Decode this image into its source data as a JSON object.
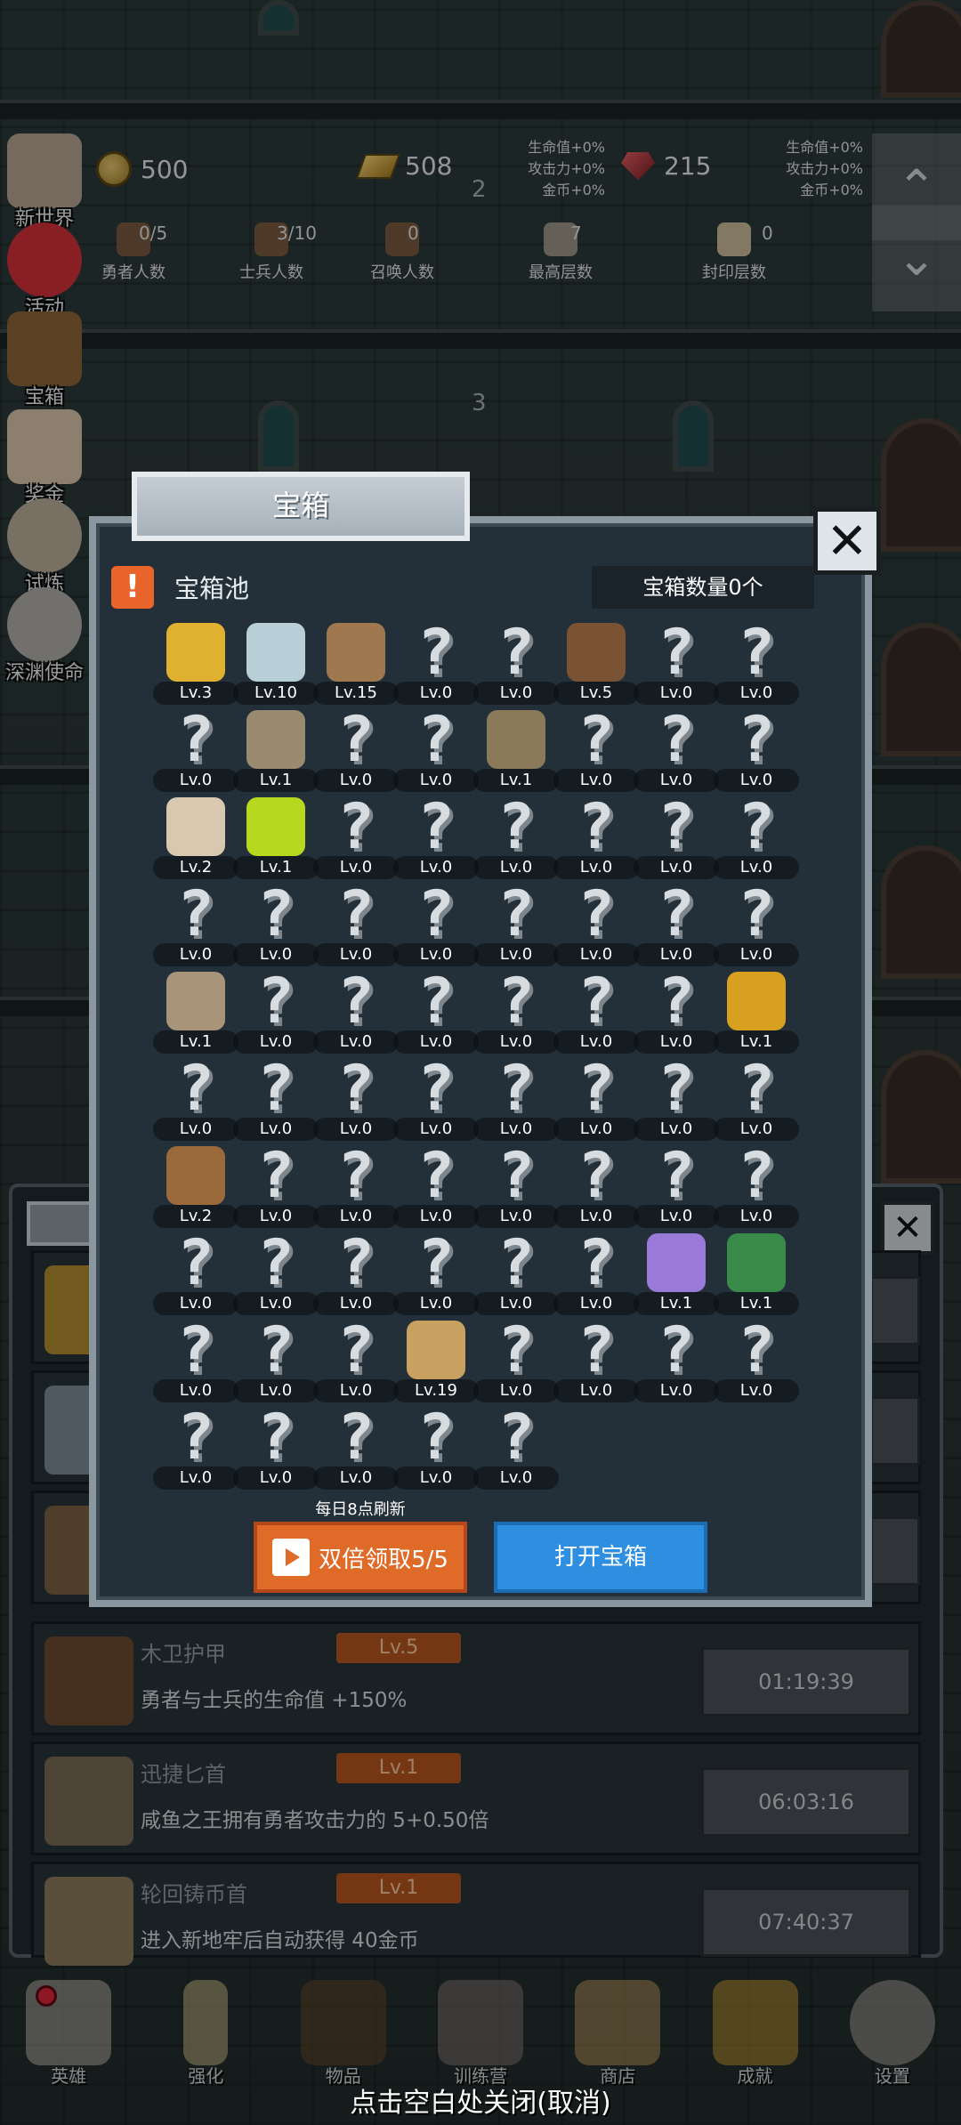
{
  "hud": {
    "coins": "500",
    "bars": "508",
    "gems": "215",
    "buff_left": [
      "生命值+0%",
      "攻击力+0%",
      "金币+0%"
    ],
    "buff_right": [
      "生命值+0%",
      "攻击力+0%",
      "金币+0%"
    ],
    "floor_top": "2",
    "floor_mid": "3",
    "stats": [
      {
        "value": "0/5",
        "label": "勇者人数"
      },
      {
        "value": "3/10",
        "label": "士兵人数"
      },
      {
        "value": "0",
        "label": "召唤人数"
      },
      {
        "value": "7",
        "label": "最高层数"
      },
      {
        "value": "0",
        "label": "封印层数"
      }
    ],
    "up_arrow": "⌃",
    "down_arrow": "⌄"
  },
  "side_menu": [
    {
      "label": "新世界",
      "icon": "stone-tablet-icon"
    },
    {
      "label": "活动",
      "icon": "heart-icon"
    },
    {
      "label": "宝箱",
      "icon": "treasure-chest-icon"
    },
    {
      "label": "奖金",
      "icon": "envelope-icon"
    },
    {
      "label": "试炼",
      "icon": "feather-icon"
    },
    {
      "label": "深渊使命",
      "icon": "orb-icon"
    }
  ],
  "modal": {
    "title": "宝箱",
    "close": "✕",
    "warn": "!",
    "pool_title": "宝箱池",
    "chest_count": "宝箱数量0个",
    "refresh_note": "每日8点刷新",
    "double_button": "双倍领取5/5",
    "open_button": "打开宝箱",
    "unknown_glyph": "?",
    "items": [
      {
        "lv": "Lv.3",
        "icon": "crown-icon",
        "color": "#e0b030"
      },
      {
        "lv": "Lv.10",
        "icon": "diamond-icon",
        "color": "#b8cfd8"
      },
      {
        "lv": "Lv.15",
        "icon": "wooden-sword-icon",
        "color": "#a07850"
      },
      {
        "lv": "Lv.0"
      },
      {
        "lv": "Lv.0"
      },
      {
        "lv": "Lv.5",
        "icon": "leather-armor-icon",
        "color": "#7a5234"
      },
      {
        "lv": "Lv.0"
      },
      {
        "lv": "Lv.0"
      },
      {
        "lv": "Lv.0"
      },
      {
        "lv": "Lv.1",
        "icon": "dagger-icon",
        "color": "#9a8a70"
      },
      {
        "lv": "Lv.0"
      },
      {
        "lv": "Lv.0"
      },
      {
        "lv": "Lv.1",
        "icon": "knight-helmet-icon",
        "color": "#8a7a5a"
      },
      {
        "lv": "Lv.0"
      },
      {
        "lv": "Lv.0"
      },
      {
        "lv": "Lv.0"
      },
      {
        "lv": "Lv.2",
        "icon": "bread-icon",
        "color": "#d8c8b0"
      },
      {
        "lv": "Lv.1",
        "icon": "potion-icon",
        "color": "#b8d820"
      },
      {
        "lv": "Lv.0"
      },
      {
        "lv": "Lv.0"
      },
      {
        "lv": "Lv.0"
      },
      {
        "lv": "Lv.0"
      },
      {
        "lv": "Lv.0"
      },
      {
        "lv": "Lv.0"
      },
      {
        "lv": "Lv.0"
      },
      {
        "lv": "Lv.0"
      },
      {
        "lv": "Lv.0"
      },
      {
        "lv": "Lv.0"
      },
      {
        "lv": "Lv.0"
      },
      {
        "lv": "Lv.0"
      },
      {
        "lv": "Lv.0"
      },
      {
        "lv": "Lv.0"
      },
      {
        "lv": "Lv.1",
        "icon": "boot-icon",
        "color": "#a89478"
      },
      {
        "lv": "Lv.0"
      },
      {
        "lv": "Lv.0"
      },
      {
        "lv": "Lv.0"
      },
      {
        "lv": "Lv.0"
      },
      {
        "lv": "Lv.0"
      },
      {
        "lv": "Lv.0"
      },
      {
        "lv": "Lv.1",
        "icon": "torch-icon",
        "color": "#d8a020"
      },
      {
        "lv": "Lv.0"
      },
      {
        "lv": "Lv.0"
      },
      {
        "lv": "Lv.0"
      },
      {
        "lv": "Lv.0"
      },
      {
        "lv": "Lv.0"
      },
      {
        "lv": "Lv.0"
      },
      {
        "lv": "Lv.0"
      },
      {
        "lv": "Lv.0"
      },
      {
        "lv": "Lv.2",
        "icon": "backpack-icon",
        "color": "#9a6a3a"
      },
      {
        "lv": "Lv.0"
      },
      {
        "lv": "Lv.0"
      },
      {
        "lv": "Lv.0"
      },
      {
        "lv": "Lv.0"
      },
      {
        "lv": "Lv.0"
      },
      {
        "lv": "Lv.0"
      },
      {
        "lv": "Lv.0"
      },
      {
        "lv": "Lv.0"
      },
      {
        "lv": "Lv.0"
      },
      {
        "lv": "Lv.0"
      },
      {
        "lv": "Lv.0"
      },
      {
        "lv": "Lv.0"
      },
      {
        "lv": "Lv.0"
      },
      {
        "lv": "Lv.1",
        "icon": "tentacle-icon",
        "color": "#9a7ad8"
      },
      {
        "lv": "Lv.1",
        "icon": "hex-amulet-icon",
        "color": "#3a8a4a"
      },
      {
        "lv": "Lv.0"
      },
      {
        "lv": "Lv.0"
      },
      {
        "lv": "Lv.0"
      },
      {
        "lv": "Lv.19",
        "icon": "beer-mug-icon",
        "color": "#c8a060"
      },
      {
        "lv": "Lv.0"
      },
      {
        "lv": "Lv.0"
      },
      {
        "lv": "Lv.0"
      },
      {
        "lv": "Lv.0"
      },
      {
        "lv": "Lv.0"
      },
      {
        "lv": "Lv.0"
      },
      {
        "lv": "Lv.0"
      },
      {
        "lv": "Lv.0"
      },
      {
        "lv": "Lv.0"
      }
    ]
  },
  "list": [
    {
      "name": "木卫护甲",
      "lv": "Lv.5",
      "desc": "勇者与士兵的生命值 +150%",
      "timer": "01:19:39",
      "icon": "leather-armor-icon",
      "color": "#6a4a30"
    },
    {
      "name": "迅捷匕首",
      "lv": "Lv.1",
      "desc": "咸鱼之王拥有勇者攻击力的 5+0.50倍",
      "timer": "06:03:16",
      "icon": "dagger-icon",
      "color": "#8a7a60"
    },
    {
      "name": "轮回铸币首",
      "lv": "Lv.1",
      "desc": "进入新地牢后自动获得 40金币",
      "timer": "07:40:37",
      "icon": "knight-helmet-icon",
      "color": "#8a7a5a"
    }
  ],
  "nav": [
    {
      "label": "英雄",
      "icon": "skull-icon",
      "badge": true
    },
    {
      "label": "强化",
      "icon": "candle-icon"
    },
    {
      "label": "物品",
      "icon": "book-icon"
    },
    {
      "label": "训练营",
      "icon": "lantern-icon"
    },
    {
      "label": "商店",
      "icon": "mug-icon"
    },
    {
      "label": "成就",
      "icon": "key-icon"
    },
    {
      "label": "设置",
      "icon": "gear-icon"
    }
  ],
  "close_hint": "点击空白处关闭(取消)",
  "colors": {
    "accent_orange": "#e06a28",
    "accent_blue": "#2e8ee0",
    "level_badge": "#b2541e",
    "modal_bg": "#243039"
  }
}
